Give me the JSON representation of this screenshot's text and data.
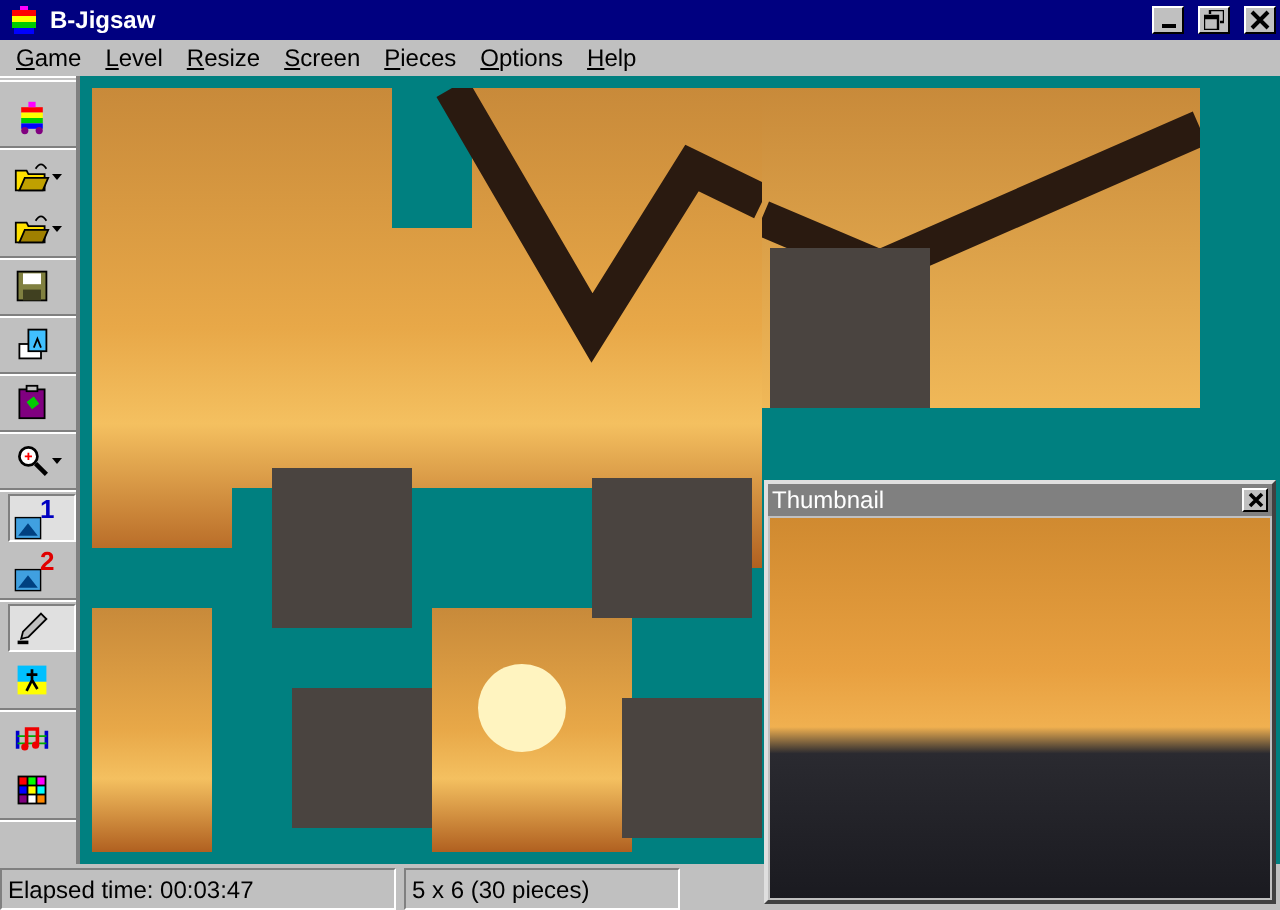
{
  "window": {
    "title": "B-Jigsaw"
  },
  "menu": [
    {
      "label": "Game"
    },
    {
      "label": "Level"
    },
    {
      "label": "Resize"
    },
    {
      "label": "Screen"
    },
    {
      "label": "Pieces"
    },
    {
      "label": "Options"
    },
    {
      "label": "Help"
    }
  ],
  "toolbar": {
    "groups": [
      [
        {
          "kind": "puzzle",
          "dropdown": false,
          "selected": false
        }
      ],
      [
        {
          "kind": "folder-arrow",
          "dropdown": true,
          "selected": false
        },
        {
          "kind": "folder-open",
          "dropdown": true,
          "selected": false
        }
      ],
      [
        {
          "kind": "floppy",
          "dropdown": false,
          "selected": false
        }
      ],
      [
        {
          "kind": "picture",
          "dropdown": false,
          "selected": false
        }
      ],
      [
        {
          "kind": "clipboard",
          "dropdown": false,
          "selected": false
        }
      ],
      [
        {
          "kind": "magnifier",
          "dropdown": true,
          "selected": false
        }
      ],
      [
        {
          "kind": "one",
          "label": "1",
          "dropdown": false,
          "selected": true
        },
        {
          "kind": "two",
          "label": "2",
          "dropdown": false,
          "selected": false
        }
      ],
      [
        {
          "kind": "pencil",
          "dropdown": false,
          "selected": true
        },
        {
          "kind": "runner",
          "dropdown": false,
          "selected": false
        }
      ],
      [
        {
          "kind": "music",
          "dropdown": false,
          "selected": false
        },
        {
          "kind": "palette",
          "dropdown": false,
          "selected": false
        }
      ]
    ]
  },
  "thumbnail": {
    "title": "Thumbnail"
  },
  "status_bar": [
    {
      "text": "Elapsed time: 00:03:47"
    },
    {
      "text": "5 x 6 (30 pieces)"
    }
  ]
}
